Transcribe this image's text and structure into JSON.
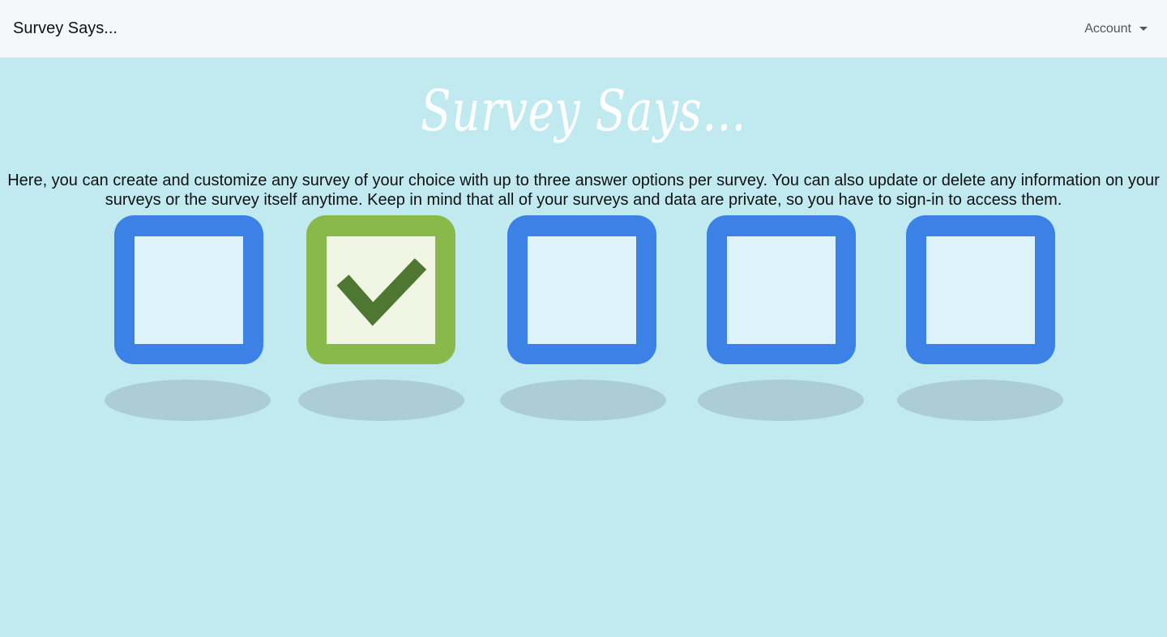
{
  "navbar": {
    "brand": "Survey Says...",
    "account_label": "Account"
  },
  "hero": {
    "title": "Survey Says...",
    "description": "Here, you can create and customize any survey of your choice with up to three answer options per survey. You can also update or delete any information on your surveys or the survey itself anytime. Keep in mind that all of your surveys and data are private, so you have to sign-in to access them."
  },
  "checkboxes": [
    {
      "checked": false,
      "color": "#3c82e6"
    },
    {
      "checked": true,
      "color": "#89b84b"
    },
    {
      "checked": false,
      "color": "#3c82e6"
    },
    {
      "checked": false,
      "color": "#3c82e6"
    },
    {
      "checked": false,
      "color": "#3c82e6"
    }
  ]
}
